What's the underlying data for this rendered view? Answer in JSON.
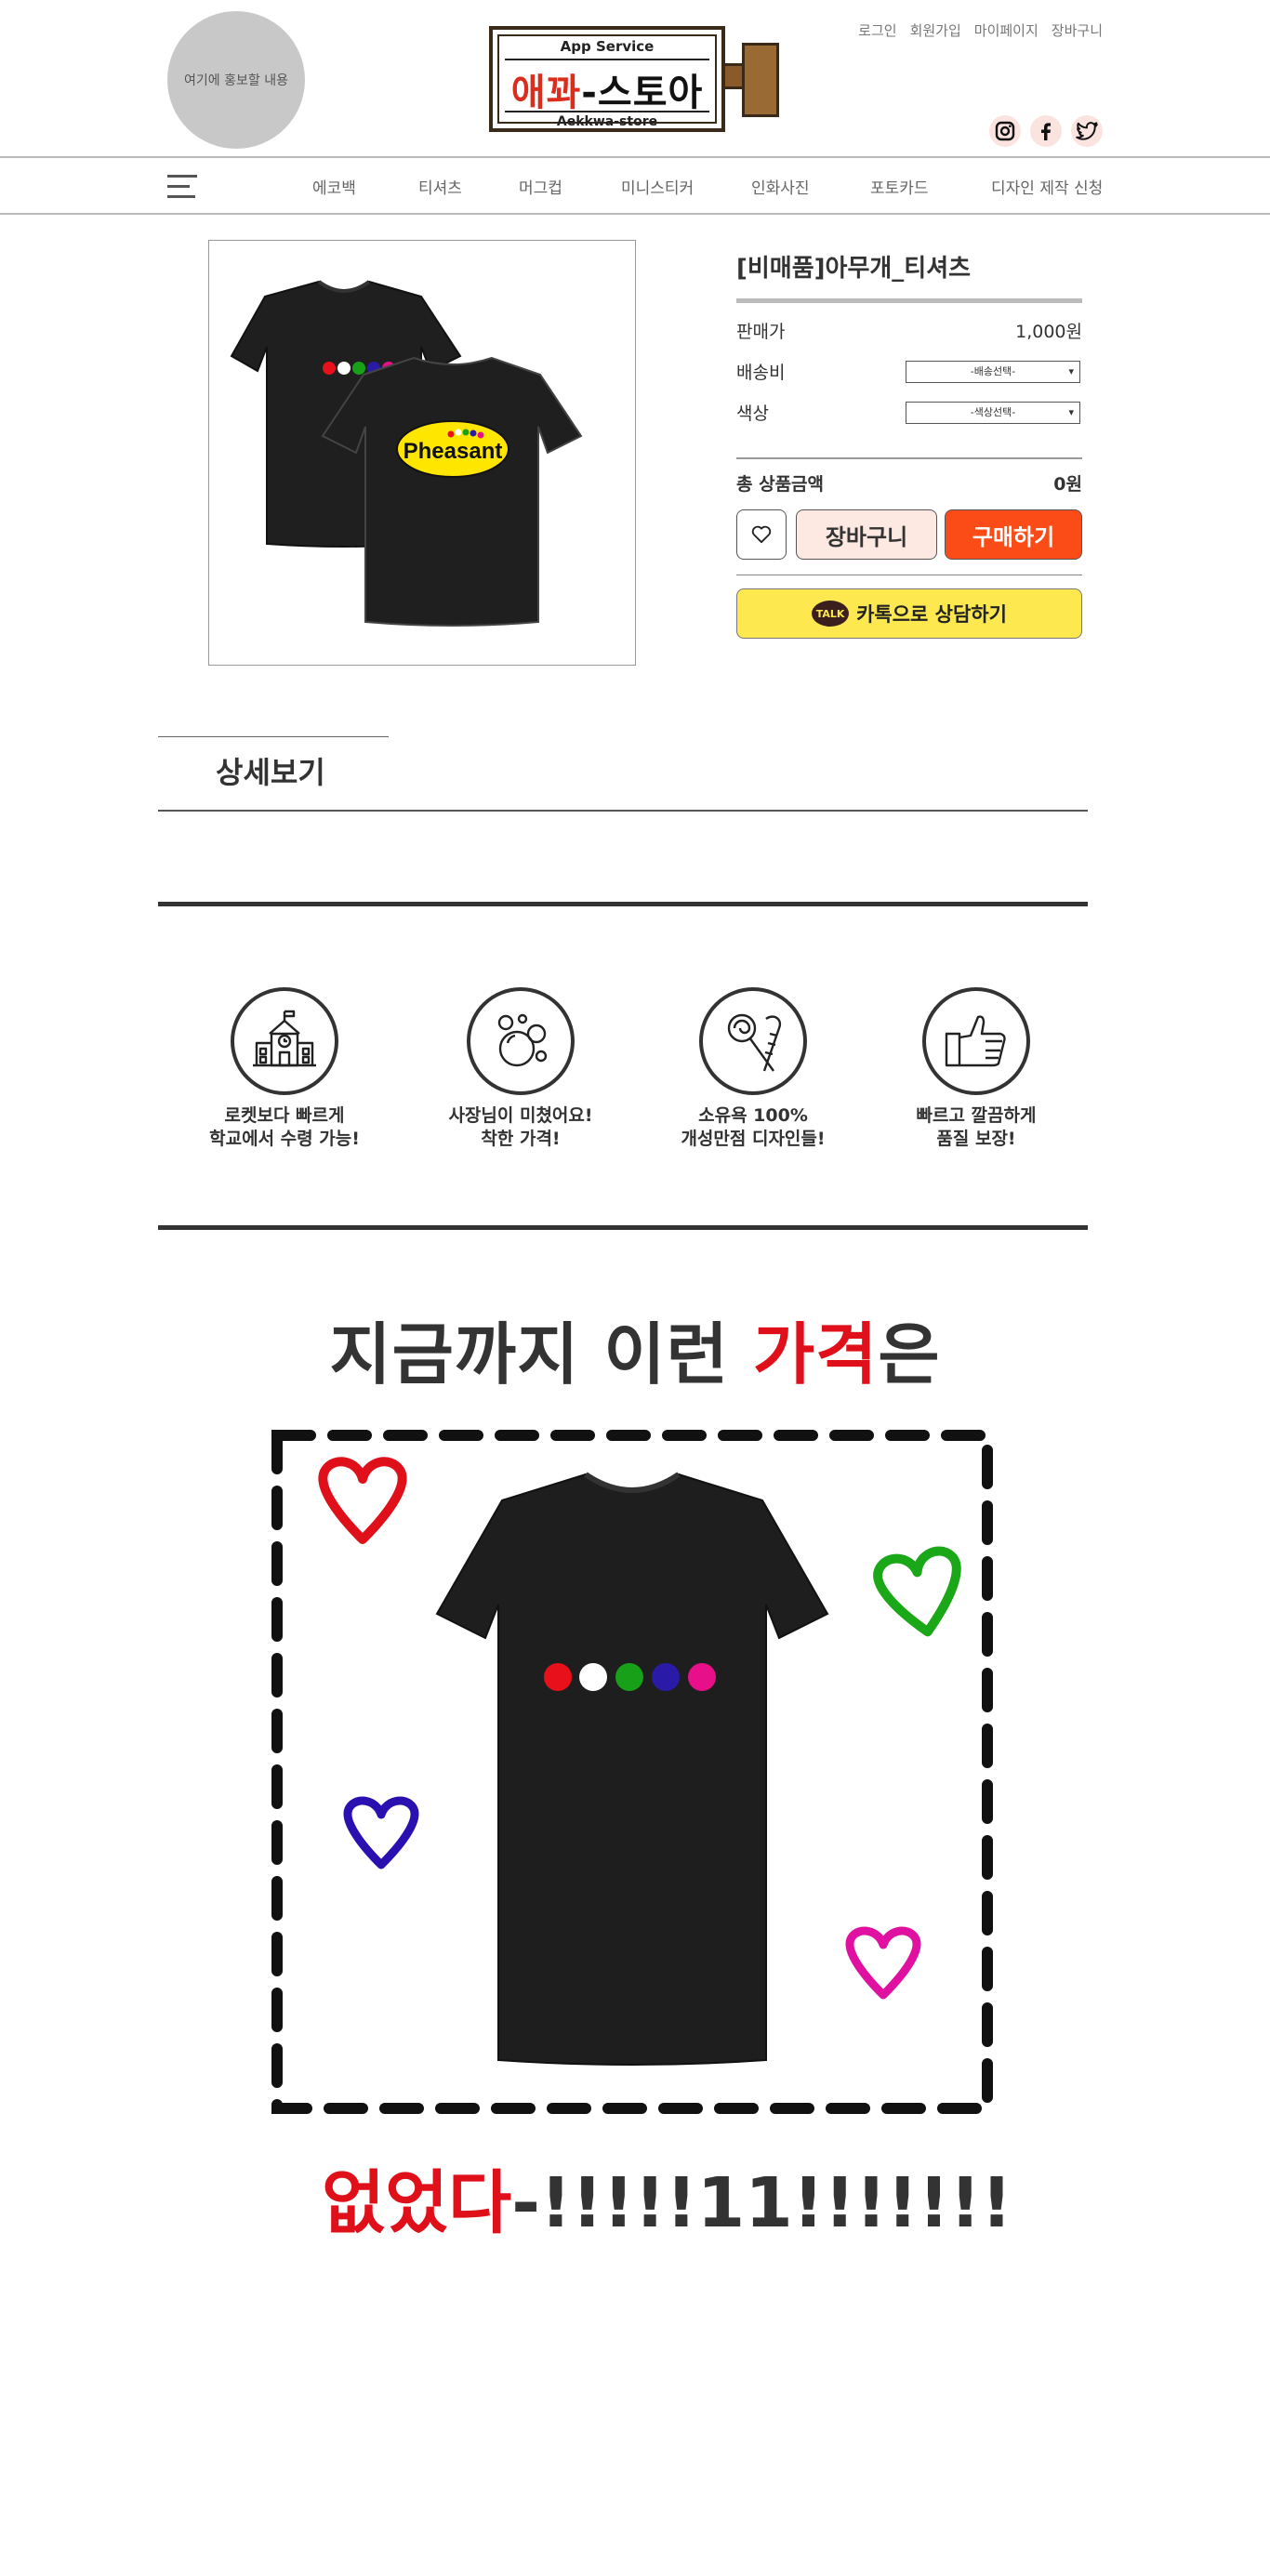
{
  "header": {
    "promo_text": "여기에 홍보할 내용",
    "logo": {
      "top": "App Service",
      "main_red": "애꽈",
      "main_black": "-스토아",
      "bottom": "Aekkwa-store"
    },
    "top_links": [
      "로그인",
      "회원가입",
      "마이페이지",
      "장바구니"
    ],
    "social": [
      "instagram-icon",
      "facebook-icon",
      "twitter-icon"
    ]
  },
  "nav": {
    "items": [
      "에코백",
      "티셔츠",
      "머그컵",
      "미니스티커",
      "인화사진",
      "포토카드",
      "디자인 제작 신청"
    ]
  },
  "product": {
    "title": "[비매품]아무개_티셔츠",
    "price_label": "판매가",
    "price_value": "1,000원",
    "shipping_label": "배송비",
    "shipping_select": "-배송선택-",
    "color_label": "색상",
    "color_select": "-색상선택-",
    "total_label": "총 상품금액",
    "total_value": "0원",
    "wish_icon": "heart-icon",
    "cart_label": "장바구니",
    "buy_label": "구매하기",
    "kakao_badge": "TALK",
    "kakao_label": "카톡으로 상담하기",
    "back_print": "Pheasant",
    "dot_colors": [
      "#e8101a",
      "#ffffff",
      "#18a018",
      "#2a1aa8",
      "#e8108a"
    ]
  },
  "detail": {
    "title": "상세보기"
  },
  "features": [
    {
      "line1": "로켓보다 빠르게",
      "line2": "학교에서 수령 가능!",
      "icon": "school-icon"
    },
    {
      "line1": "사장님이 미쳤어요!",
      "line2": "착한 가격!",
      "icon": "bubbles-icon"
    },
    {
      "line1": "소유욕 100%",
      "line2": "개성만점 디자인들!",
      "icon": "candy-icon"
    },
    {
      "line1": "빠르고 깔끔하게",
      "line2": "품질 보장!",
      "icon": "thumbs-up-icon"
    }
  ],
  "promo": {
    "head_black": "지금까지 이런 ",
    "head_red": "가격",
    "head_black2": "은",
    "tail_red": "없었다",
    "tail_black": "-!!!!!11!!!!!!!",
    "heart_colors": [
      "#e0101a",
      "#1aa818",
      "#2a10b0",
      "#e010a0"
    ]
  }
}
